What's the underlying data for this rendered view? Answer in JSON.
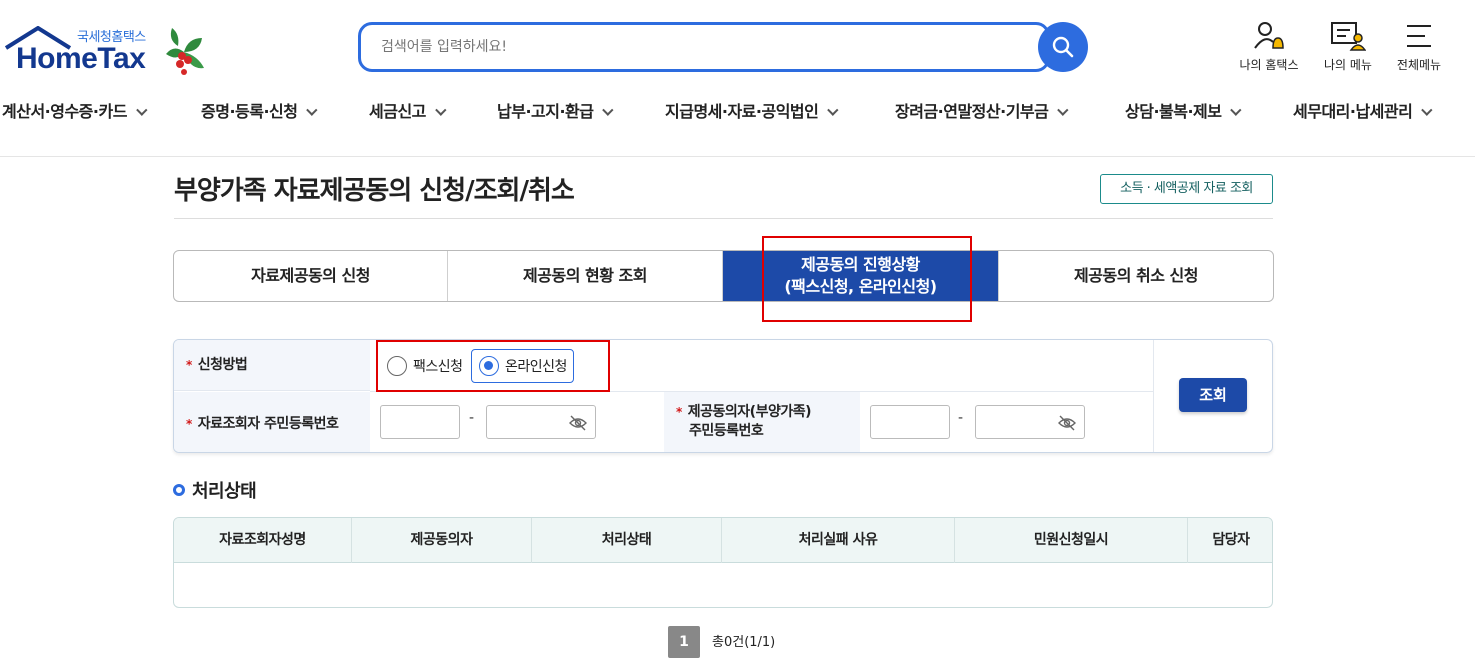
{
  "header": {
    "logo_small": "국세청홈택스",
    "logo_main": "HomeTax",
    "search_placeholder": "검색어를 입력하세요!",
    "my_hometax": "나의 홈택스",
    "my_menu": "나의 메뉴",
    "all_menu": "전체메뉴"
  },
  "nav": [
    "계산서·영수증·카드",
    "증명·등록·신청",
    "세금신고",
    "납부·고지·환급",
    "지급명세·자료·공익법인",
    "장려금·연말정산·기부금",
    "상담·불복·제보",
    "세무대리·납세관리"
  ],
  "page": {
    "title": "부양가족 자료제공동의 신청/조회/취소",
    "link_button": "소득 · 세액공제 자료 조회"
  },
  "tabs": [
    {
      "label": "자료제공동의 신청",
      "active": false
    },
    {
      "label": "제공동의 현황 조회",
      "active": false
    },
    {
      "label": "제공동의 진행상황\n(팩스신청, 온라인신청)",
      "active": true
    },
    {
      "label": "제공동의 취소 신청",
      "active": false
    }
  ],
  "form": {
    "method_label": "신청방법",
    "radio_fax": "팩스신청",
    "radio_online": "온라인신청",
    "selected_method": "온라인신청",
    "requester_label": "자료조회자 주민등록번호",
    "consenter_label_1": "제공동의자(부양가족)",
    "consenter_label_2": "주민등록번호",
    "dash": "-",
    "query_button": "조회"
  },
  "section": {
    "title": "처리상태"
  },
  "table": {
    "columns": [
      "자료조회자성명",
      "제공동의자",
      "처리상태",
      "처리실패 사유",
      "민원신청일시",
      "담당자"
    ],
    "rows": []
  },
  "pagination": {
    "current_page": "1",
    "total_text": "총0건(1/1)"
  },
  "colors": {
    "primary": "#1d4aa8",
    "accent": "#2d6cdf",
    "highlight": "#e00000"
  }
}
